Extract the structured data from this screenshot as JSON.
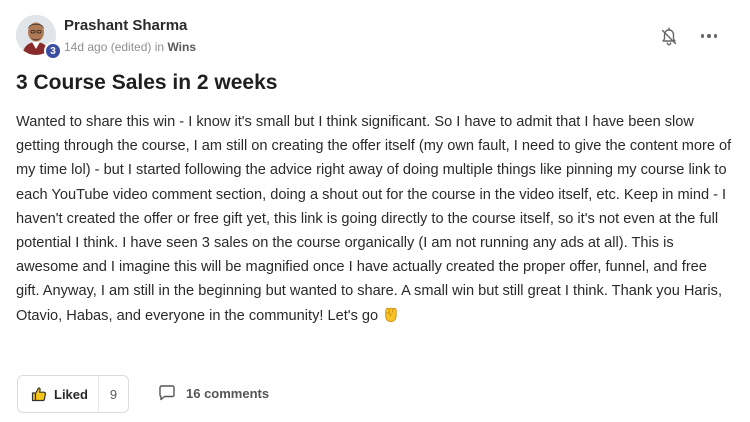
{
  "post": {
    "author": {
      "name": "Prashant Sharma",
      "level": "3",
      "avatar": "avatar"
    },
    "meta": {
      "time": "14d ago (edited)",
      "in_word": "in",
      "category": "Wins"
    },
    "title": "3 Course Sales in 2 weeks",
    "body": "Wanted to share this win - I know it's small but I think significant. So I have to admit that I have been slow getting through the course, I am still on creating the offer itself (my own fault, I need to give the content more of my time lol) - but I started following the advice right away of doing multiple things like pinning my course link to each YouTube video comment section, doing a shout out for the course in the video itself, etc. Keep in mind - I haven't created the offer or free gift yet, this link is going directly to the course itself, so it's not even at the full potential I think. I have seen 3 sales on the course organically (I am not running any ads at all). This is awesome and I imagine this will be magnified once I have actually created the proper offer, funnel, and free gift. Anyway, I am still in the beginning but wanted to share. A small win but still great I think. Thank you Haris, Otavio, Habas, and everyone in the community! Let's go",
    "body_emoji": "raised-fist-icon"
  },
  "header_actions": {
    "notify_icon": "bell-off-icon",
    "more_icon": "more-horizontal-icon"
  },
  "actions": {
    "like_label": "Liked",
    "like_count": "9",
    "like_icon": "thumbs-up-icon",
    "comments_label": "16 comments",
    "comments_icon": "comment-bubble-icon"
  },
  "colors": {
    "level_badge": "#3b4ea2",
    "liked_thumb": "#f5c518"
  }
}
